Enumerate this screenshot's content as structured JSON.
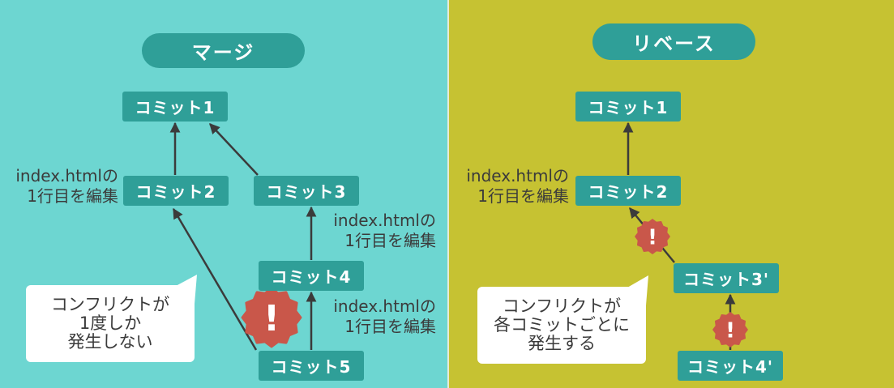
{
  "colors": {
    "merge_background": "#6dd6d1",
    "rebase_background": "#c6c232",
    "node": "#2f9f98",
    "node_text": "#ffffff",
    "conflict": "#c9574a",
    "arrow": "#3b3b3b",
    "label_text": "#3b3b3b",
    "callout_background": "#ffffff"
  },
  "merge": {
    "title": "マージ",
    "commits": {
      "commit1": "コミット1",
      "commit2": "コミット2",
      "commit3": "コミット3",
      "commit4": "コミット4",
      "commit5": "コミット5"
    },
    "edit_notes": [
      {
        "line1": "index.htmlの",
        "line2": "1行目を編集"
      },
      {
        "line1": "index.htmlの",
        "line2": "1行目を編集"
      },
      {
        "line1": "index.htmlの",
        "line2": "1行目を編集"
      }
    ],
    "callout": {
      "line1": "コンフリクトが",
      "line2": "1度しか",
      "line3": "発生しない"
    },
    "conflict_marks": [
      {
        "icon": "conflict-warning-icon",
        "symbol": "!"
      }
    ]
  },
  "rebase": {
    "title": "リベース",
    "commits": {
      "commit1": "コミット1",
      "commit2": "コミット2",
      "commit3": "コミット3'",
      "commit4": "コミット4'"
    },
    "edit_notes": [
      {
        "line1": "index.htmlの",
        "line2": "1行目を編集"
      }
    ],
    "callout": {
      "line1": "コンフリクトが",
      "line2": "各コミットごとに",
      "line3": "発生する"
    },
    "conflict_marks": [
      {
        "icon": "conflict-warning-icon",
        "symbol": "!"
      },
      {
        "icon": "conflict-warning-icon",
        "symbol": "!"
      }
    ]
  }
}
